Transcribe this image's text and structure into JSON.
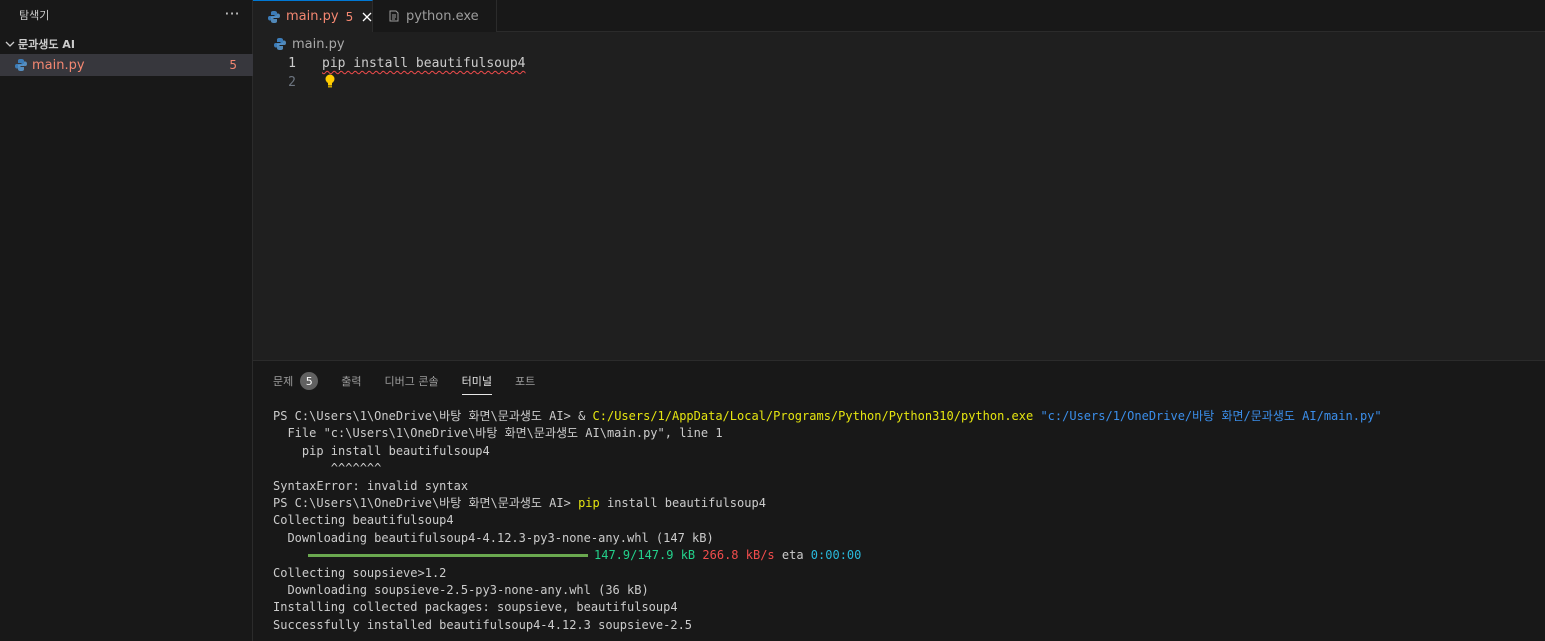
{
  "sidebar": {
    "title": "탐색기",
    "more_glyph": "···",
    "folder_name": "문과생도 AI",
    "file": {
      "name": "main.py",
      "problems": "5"
    }
  },
  "tabs": [
    {
      "label": "main.py",
      "badge": "5"
    },
    {
      "label": "python.exe"
    }
  ],
  "breadcrumb": {
    "file": "main.py"
  },
  "editor": {
    "lines": [
      {
        "number": "1",
        "text": "pip install beautifulsoup4"
      },
      {
        "number": "2",
        "text": ""
      }
    ]
  },
  "panel": {
    "tabs": [
      {
        "label": "문제",
        "badge": "5"
      },
      {
        "label": "출력"
      },
      {
        "label": "디버그 콘솔"
      },
      {
        "label": "터미널"
      },
      {
        "label": "포트"
      }
    ],
    "active_tab": "터미널"
  },
  "terminal": {
    "l1_prompt": "PS C:\\Users\\1\\OneDrive\\바탕 화면\\문과생도 AI> ",
    "l1_amp": "& ",
    "l1_exe": "C:/Users/1/AppData/Local/Programs/Python/Python310/python.exe",
    "l1_arg": " \"c:/Users/1/OneDrive/바탕 화면/문과생도 AI/main.py\"",
    "l2": "  File \"c:\\Users\\1\\OneDrive\\바탕 화면\\문과생도 AI\\main.py\", line 1",
    "l3": "    pip install beautifulsoup4",
    "l4": "        ^^^^^^^",
    "l5": "SyntaxError: invalid syntax",
    "l6_prompt": "PS C:\\Users\\1\\OneDrive\\바탕 화면\\문과생도 AI> ",
    "l6_cmd": "pip",
    "l6_rest": " install beautifulsoup4",
    "l7": "Collecting beautifulsoup4",
    "l8": "  Downloading beautifulsoup4-4.12.3-py3-none-any.whl (147 kB)",
    "l9_size": "147.9/147.9 kB",
    "l9_speed": "266.8 kB/s",
    "l9_eta_label": "eta",
    "l9_eta": "0:00:00",
    "l9_progress": 1.0,
    "l10": "Collecting soupsieve>1.2",
    "l11": "  Downloading soupsieve-2.5-py3-none-any.whl (36 kB)",
    "l12": "Installing collected packages: soupsieve, beautifulsoup4",
    "l13": "Successfully installed beautifulsoup4-4.12.3 soupsieve-2.5"
  },
  "colors": {
    "error": "#f48771",
    "accent": "#0078d4",
    "progress": "#6aa84f"
  },
  "icons": [
    "python-icon",
    "terminal-icon",
    "close-icon",
    "chevron-down-icon",
    "lightbulb-icon",
    "more-icon"
  ]
}
